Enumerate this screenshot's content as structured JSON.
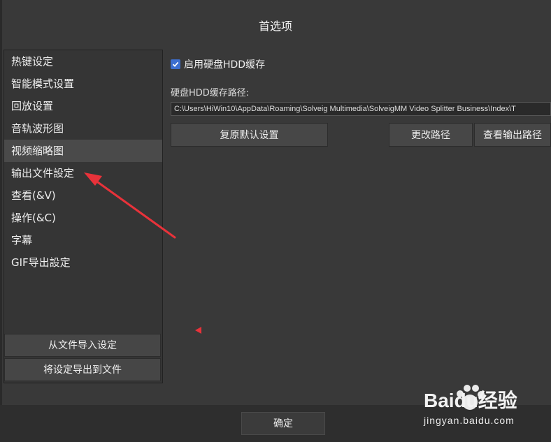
{
  "dialog": {
    "title": "首选项"
  },
  "sidebar": {
    "items": [
      {
        "label": "热键设定"
      },
      {
        "label": "智能模式设置"
      },
      {
        "label": "回放设置"
      },
      {
        "label": "音轨波形图"
      },
      {
        "label": "视频缩略图",
        "selected": true
      },
      {
        "label": "输出文件設定"
      },
      {
        "label": "查看(&V)"
      },
      {
        "label": "操作(&C)"
      },
      {
        "label": "字幕"
      },
      {
        "label": "GIF导出設定"
      }
    ],
    "import_button": "从文件导入设定",
    "export_button": "将设定导出到文件"
  },
  "content": {
    "checkbox_label": "启用硬盘HDD缓存",
    "checkbox_checked": true,
    "path_label": "硬盘HDD缓存路径:",
    "path_value": "C:\\Users\\HiWin10\\AppData\\Roaming\\Solveig Multimedia\\SolveigMM Video Splitter Business\\Index\\T",
    "reset_button": "复原默认设置",
    "change_path_button": "更改路径",
    "view_output_path_button": "查看输出路径"
  },
  "footer": {
    "ok_button": "确定"
  },
  "watermark": {
    "brand": "Baidu经验",
    "url": "jingyan.baidu.com"
  },
  "colors": {
    "annotation_arrow": "#e8323a",
    "checkbox_accent": "#3d6fd0",
    "background": "#393939"
  }
}
